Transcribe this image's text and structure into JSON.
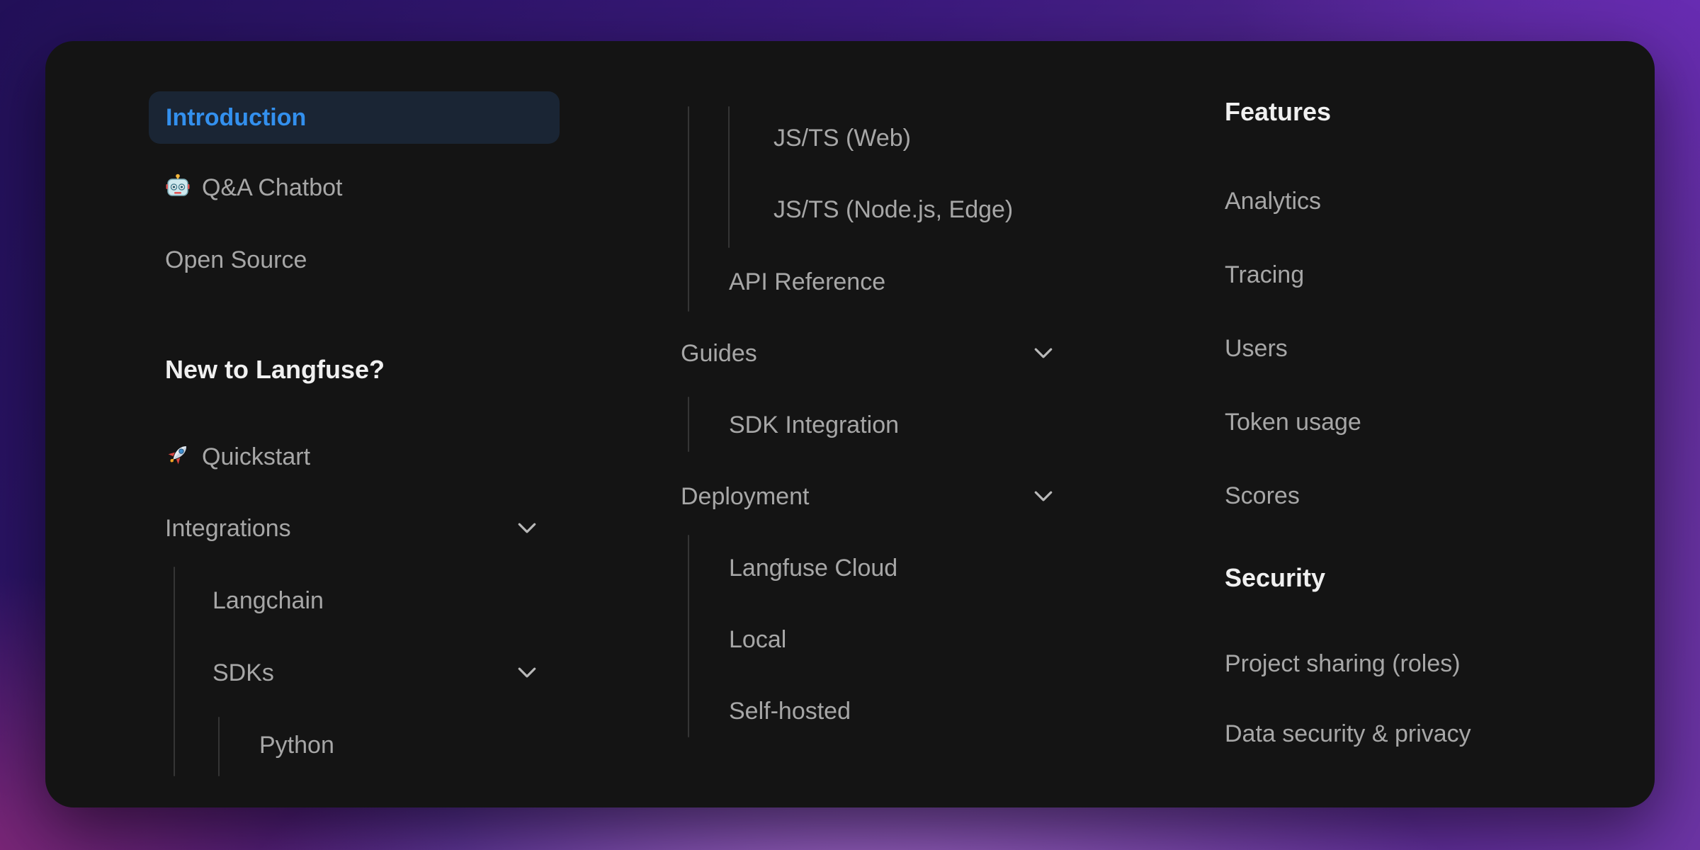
{
  "theme": {
    "accent_blue": "#3390ee",
    "active_item_bg": "#1a2534",
    "card_bg": "#141414",
    "item_text": "#a7a7a7",
    "heading_text": "#f0f0f0",
    "guide_line": "rgba(255,255,255,0.14)",
    "bg_corner_top_left": "#221058",
    "bg_corner_top_right": "#6a2cb8",
    "bg_corner_bottom_left": "#8c2a7a",
    "bg_corner_bottom_right": "#6c34a4",
    "bg_bottom_center_glow": "#b67ad2"
  },
  "sidebar": {
    "columns": [
      {
        "name": "left",
        "items": [
          {
            "label": "Introduction",
            "state": "active"
          },
          {
            "label": "Q&A Chatbot",
            "icon": "robot-emoji"
          },
          {
            "label": "Open Source"
          },
          {
            "label": "New to Langfuse?",
            "role": "section-header"
          },
          {
            "label": "Quickstart",
            "icon": "rocket-emoji"
          },
          {
            "label": "Integrations",
            "expandable": true,
            "icon": "chevron-down"
          },
          {
            "label": "Langchain",
            "level": 2
          },
          {
            "label": "SDKs",
            "level": 2,
            "expandable": true,
            "icon": "chevron-down"
          },
          {
            "label": "Python",
            "level": 3
          }
        ]
      },
      {
        "name": "middle",
        "items": [
          {
            "label": "JS/TS (Web)",
            "level": 3
          },
          {
            "label": "JS/TS (Node.js, Edge)",
            "level": 3
          },
          {
            "label": "API Reference",
            "level": 2
          },
          {
            "label": "Guides",
            "expandable": true,
            "icon": "chevron-down"
          },
          {
            "label": "SDK Integration",
            "level": 2
          },
          {
            "label": "Deployment",
            "expandable": true,
            "icon": "chevron-down"
          },
          {
            "label": "Langfuse Cloud",
            "level": 2
          },
          {
            "label": "Local",
            "level": 2
          },
          {
            "label": "Self-hosted",
            "level": 2
          }
        ]
      },
      {
        "name": "right",
        "items": [
          {
            "label": "Features",
            "role": "section-header"
          },
          {
            "label": "Analytics"
          },
          {
            "label": "Tracing"
          },
          {
            "label": "Users"
          },
          {
            "label": "Token usage"
          },
          {
            "label": "Scores"
          },
          {
            "label": "Security",
            "role": "section-header"
          },
          {
            "label": "Project sharing (roles)"
          },
          {
            "label": "Data security & privacy"
          }
        ]
      }
    ]
  }
}
